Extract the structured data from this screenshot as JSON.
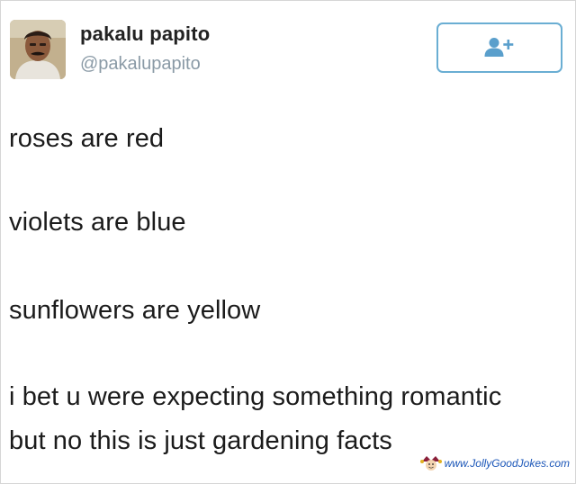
{
  "tweet": {
    "author": {
      "display_name": "pakalu papito",
      "handle": "@pakalupapito"
    },
    "follow_icon": "add-user-icon",
    "accent_color": "#6aaed3",
    "lines": [
      "roses are red",
      "violets are blue",
      "sunflowers are yellow",
      "i bet u were expecting something romantic",
      "but no this is just gardening facts"
    ]
  },
  "watermark": {
    "text": "www.JollyGoodJokes.com"
  }
}
